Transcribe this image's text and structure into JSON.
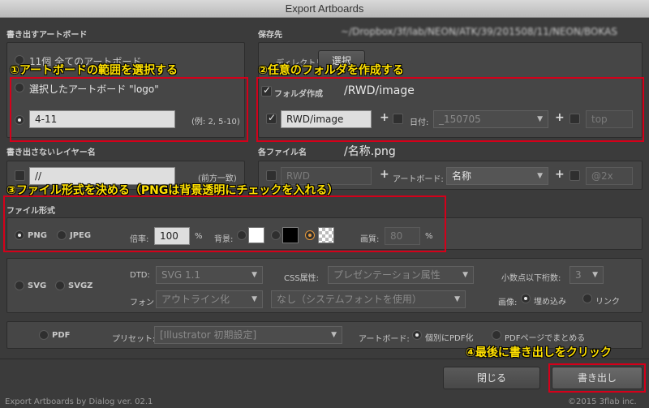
{
  "window": {
    "title": "Export Artboards"
  },
  "export_artboards": {
    "heading": "書き出すアートボード",
    "all_option": "11個 全てのアートボード",
    "selected_option": "選択したアートボード \"logo\"",
    "range_value": "4-11",
    "range_hint": "(例: 2, 5-10)"
  },
  "destination": {
    "heading": "保存先",
    "path_blurred": "~/Dropbox/3f/lab/NEON/ATK/39/201508/11/NEON/BOKAS",
    "directory_label": "ディレクトリ:",
    "select_button": "選択",
    "create_folder_label": "フォルダ作成",
    "folder_preview": "/RWD/image",
    "folder_value": "RWD/image",
    "date_label": "日付:",
    "date_value": "_150705",
    "top_value": "top"
  },
  "exclude_layers": {
    "heading": "書き出さないレイヤー名",
    "value": "//",
    "hint": "(前方一致)"
  },
  "file_names": {
    "heading": "各ファイル名",
    "preview": "/名称.png",
    "prefix_value": "RWD",
    "artboard_label": "アートボード:",
    "artboard_value": "名称",
    "suffix_value": "@2x"
  },
  "file_format": {
    "heading": "ファイル形式",
    "png": "PNG",
    "jpeg": "JPEG",
    "scale_label": "倍率:",
    "scale_value": "100",
    "scale_unit": "%",
    "bg_label": "背景:",
    "quality_label": "画質:",
    "quality_value": "80",
    "quality_unit": "%"
  },
  "svg": {
    "svg": "SVG",
    "svgz": "SVGZ",
    "dtd_label": "DTD:",
    "dtd_value": "SVG 1.1",
    "css_label": "CSS属性:",
    "css_value": "プレゼンテーション属性",
    "decimal_label": "小数点以下桁数:",
    "decimal_value": "3",
    "font_label": "フォント:",
    "font_value": "アウトライン化",
    "subset_value": "なし（システムフォントを使用）",
    "image_label": "画像:",
    "embed": "埋め込み",
    "link": "リンク"
  },
  "pdf": {
    "pdf": "PDF",
    "preset_label": "プリセット:",
    "preset_value": "[Illustrator 初期設定]",
    "artboard_label": "アートボード:",
    "individual": "個別にPDF化",
    "combine": "PDFページでまとめる"
  },
  "buttons": {
    "close": "閉じる",
    "export": "書き出し"
  },
  "footer": {
    "left": "Export Artboards by Dialog ver. 02.1",
    "right": "©2015 3flab inc."
  },
  "annotations": {
    "a1": "①アートボードの範囲を選択する",
    "a2": "②任意のフォルダを作成する",
    "a3": "③ファイル形式を決める（PNGは背景透明にチェックを入れる）",
    "a4": "④最後に書き出しをクリック"
  },
  "colors": {
    "annotation": "#ffe000",
    "highlight": "#d4001a",
    "accent_radio": "#e69a3d"
  }
}
